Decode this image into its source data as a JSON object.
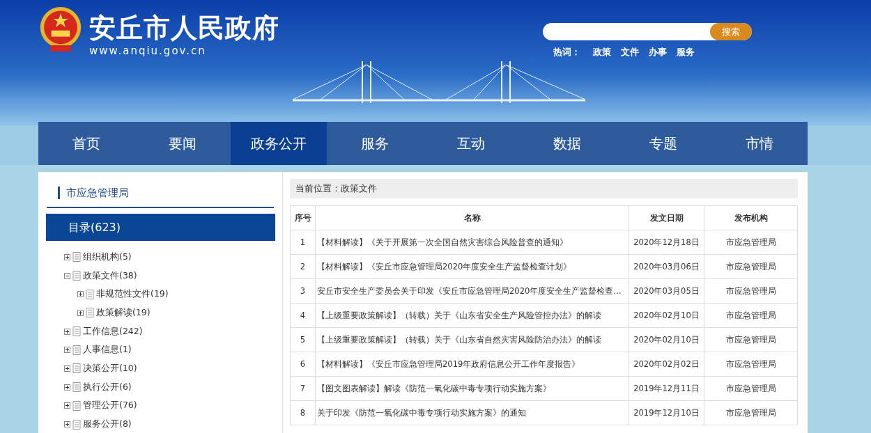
{
  "header": {
    "site_title": "安丘市人民政府",
    "site_url": "www.anqiu.gov.cn",
    "search": {
      "button": "搜索"
    },
    "hot_words_label": "热词：",
    "hot_words": [
      "政策",
      "文件",
      "办事",
      "服务"
    ]
  },
  "nav": [
    {
      "label": "首页",
      "selected": false
    },
    {
      "label": "要闻",
      "selected": false
    },
    {
      "label": "政务公开",
      "selected": true
    },
    {
      "label": "服务",
      "selected": false
    },
    {
      "label": "互动",
      "selected": false
    },
    {
      "label": "数据",
      "selected": false
    },
    {
      "label": "专题",
      "selected": false
    },
    {
      "label": "市情",
      "selected": false
    }
  ],
  "sidebar": {
    "title": "市应急管理局",
    "directory": "目录(623)",
    "tree": [
      {
        "label": "组织机构(5)",
        "expanded": false
      },
      {
        "label": "政策文件(38)",
        "expanded": true,
        "children": [
          {
            "label": "非规范性文件(19)",
            "expanded": false
          },
          {
            "label": "政策解读(19)",
            "expanded": false
          }
        ]
      },
      {
        "label": "工作信息(242)",
        "expanded": false
      },
      {
        "label": "人事信息(1)",
        "expanded": false
      },
      {
        "label": "决策公开(10)",
        "expanded": false
      },
      {
        "label": "执行公开(6)",
        "expanded": false
      },
      {
        "label": "管理公开(76)",
        "expanded": false
      },
      {
        "label": "服务公开(8)",
        "expanded": false
      }
    ]
  },
  "breadcrumb": "当前位置：政策文件",
  "table": {
    "columns": [
      "序号",
      "名称",
      "发文日期",
      "发布机构"
    ],
    "rows": [
      [
        "1",
        "【材料解读】《关于开展第一次全国自然灾害综合风险普查的通知》",
        "2020年12月18日",
        "市应急管理局"
      ],
      [
        "2",
        "【材料解读】《安丘市应急管理局2020年度安全生产监督检查计划》",
        "2020年03月06日",
        "市应急管理局"
      ],
      [
        "3",
        "安丘市安全生产委员会关于印发《安丘市应急管理局2020年度安全生产监督检查…",
        "2020年03月05日",
        "市应急管理局"
      ],
      [
        "4",
        "【上级重要政策解读】（转载）关于《山东省安全生产风险管控办法》的解读",
        "2020年02月10日",
        "市应急管理局"
      ],
      [
        "5",
        "【上级重要政策解读】（转载）关于《山东省自然灾害风险防治办法》的解读",
        "2020年02月10日",
        "市应急管理局"
      ],
      [
        "6",
        "【材料解读】《安丘市应急管理局2019年政府信息公开工作年度报告》",
        "2020年02月02日",
        "市应急管理局"
      ],
      [
        "7",
        "【图文图表解读】解读《防范一氧化碳中毒专项行动实施方案》",
        "2019年12月11日",
        "市应急管理局"
      ],
      [
        "8",
        "关于印发《防范一氧化碳中毒专项行动实施方案》的通知",
        "2019年12月10日",
        "市应急管理局"
      ]
    ]
  }
}
